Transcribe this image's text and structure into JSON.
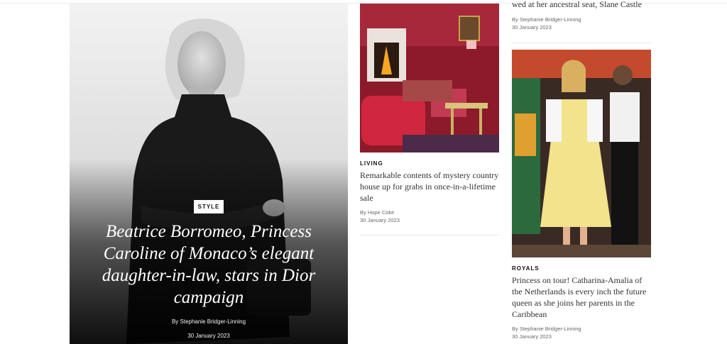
{
  "feature": {
    "category": "STYLE",
    "title": "Beatrice Borromeo, Princess Caroline of Monaco’s elegant daughter-in-law, stars in Dior campaign",
    "byline": "By Stephanie Bridger-Linning",
    "date": "30 January 2023"
  },
  "middle_article": {
    "category": "LIVING",
    "title": "Remarkable contents of mystery country house up for grabs in once-in-a-lifetime sale",
    "byline": "By Hope Coke",
    "date": "30 January 2023"
  },
  "right_top_article": {
    "title_fragment": "wed at her ancestral seat, Slane Castle",
    "byline": "By Stephanie Bridger-Linning",
    "date": "30 January 2023"
  },
  "right_article": {
    "category": "ROYALS",
    "title": "Princess on tour! Catharina-Amalia of the Netherlands is every inch the future queen as she joins her parents in the Caribbean",
    "byline": "By Stephanie Bridger-Linning",
    "date": "30 January 2023"
  }
}
